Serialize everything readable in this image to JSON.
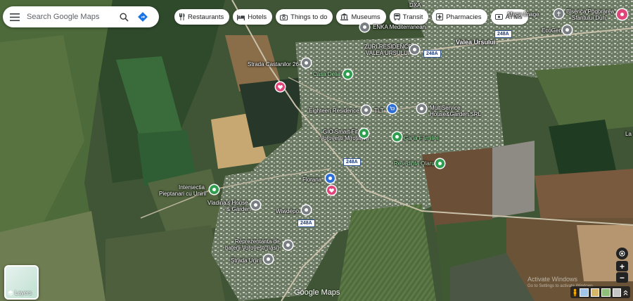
{
  "search": {
    "placeholder": "Search Google Maps"
  },
  "categories": [
    {
      "icon": "restaurant-icon",
      "label": "Restaurants"
    },
    {
      "icon": "hotel-icon",
      "label": "Hotels"
    },
    {
      "icon": "camera-icon",
      "label": "Things to do"
    },
    {
      "icon": "museum-icon",
      "label": "Museums"
    },
    {
      "icon": "transit-icon",
      "label": "Transit"
    },
    {
      "icon": "pharmacy-icon",
      "label": "Pharmacies"
    },
    {
      "icon": "atm-icon",
      "label": "ATMs"
    }
  ],
  "places": {
    "dxa": "DXA",
    "mega_image": "Mega Image",
    "biserica_1": "Biserica Pogorarea",
    "biserica_2": "Sfantului Duh",
    "enka": "ENKA Mediterranean",
    "ecogen": "EcoGen",
    "zuri_1": "ZURI RESIDENCE",
    "zuri_2": "VALEA URSULUI",
    "valea_ursului": "Valea Ursului",
    "castanilor": "Strada Castanilor 26",
    "casa_delia": "Casa Delia",
    "eighteen": "Eighteen Residence",
    "tlt": "TLT",
    "multiservice_1": "MultiService",
    "multiservice_2": "House&Garden SRL",
    "gio_1": "GIO Smart Fit",
    "gio_2": "Vorovesti Miroslava",
    "garia": "Garia Familiei",
    "resedinta": "Resedinta Olaru",
    "florana": "Florana",
    "intersectia_1": "Intersectia",
    "intersectia_2": "Pieptanari cu Unirii",
    "vladina_1": "Vladina's House",
    "vladina_2": "& Garden",
    "wiwdepo": "Wiwdepo",
    "reprezentanta_1": "Reprezentanta de",
    "reprezentanta_2": "baterii Vorovesti (Iasi)",
    "strada_unirii": "Strada Unirii",
    "la": "La"
  },
  "road_shields": {
    "r1": "248A",
    "r2": "248A",
    "r3": "248A",
    "r4": "248A"
  },
  "layers": {
    "label": "Layers"
  },
  "brand": "Google Maps",
  "watermark": {
    "line1": "Activate Windows",
    "line2": "Go to Settings to activate Windows."
  },
  "colors": {
    "accent": "#1a73e8",
    "pin_gray": "#7a7f84",
    "pin_green": "#2f9e4f",
    "pin_blue": "#2d6fd6",
    "pin_pink": "#e0467a"
  }
}
